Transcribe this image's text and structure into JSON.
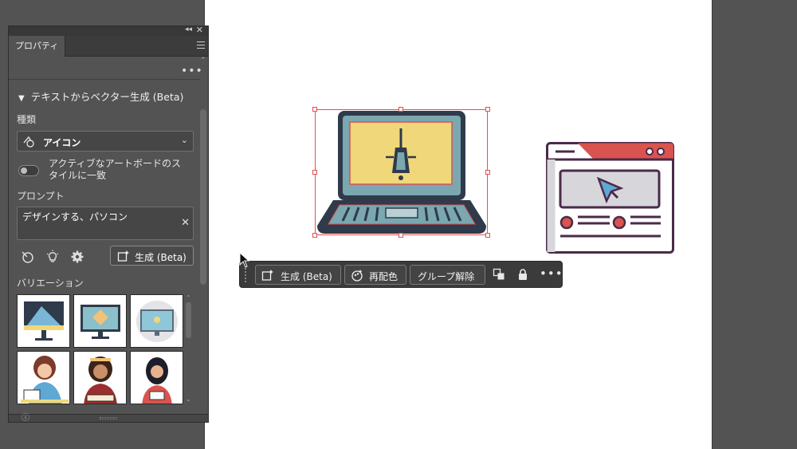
{
  "panel": {
    "tab_label": "プロパティ",
    "section_title": "テキストからベクター生成 (Beta)",
    "kind_label": "種類",
    "kind_value": "アイコン",
    "toggle_label": "アクティブなアートボードのスタイルに一致",
    "prompt_label": "プロンプト",
    "prompt_value": "デザインする、パソコン",
    "generate_label": "生成 (Beta)",
    "variations_label": "バリエーション",
    "variations": [
      {
        "name": "monitor-variation-1"
      },
      {
        "name": "monitor-variation-2"
      },
      {
        "name": "monitor-variation-3"
      },
      {
        "name": "person-variation-1"
      },
      {
        "name": "person-variation-2"
      },
      {
        "name": "person-variation-3"
      }
    ]
  },
  "taskbar": {
    "generate_label": "生成 (Beta)",
    "recolor_label": "再配色",
    "ungroup_label": "グループ解除"
  },
  "colors": {
    "selection": "#e34f4f",
    "laptop_dark": "#2f3a4a",
    "laptop_screen": "#f0d77a",
    "laptop_frame": "#7aa7b0",
    "browser_header": "#d9534f",
    "browser_cursor": "#5fa8d3"
  }
}
